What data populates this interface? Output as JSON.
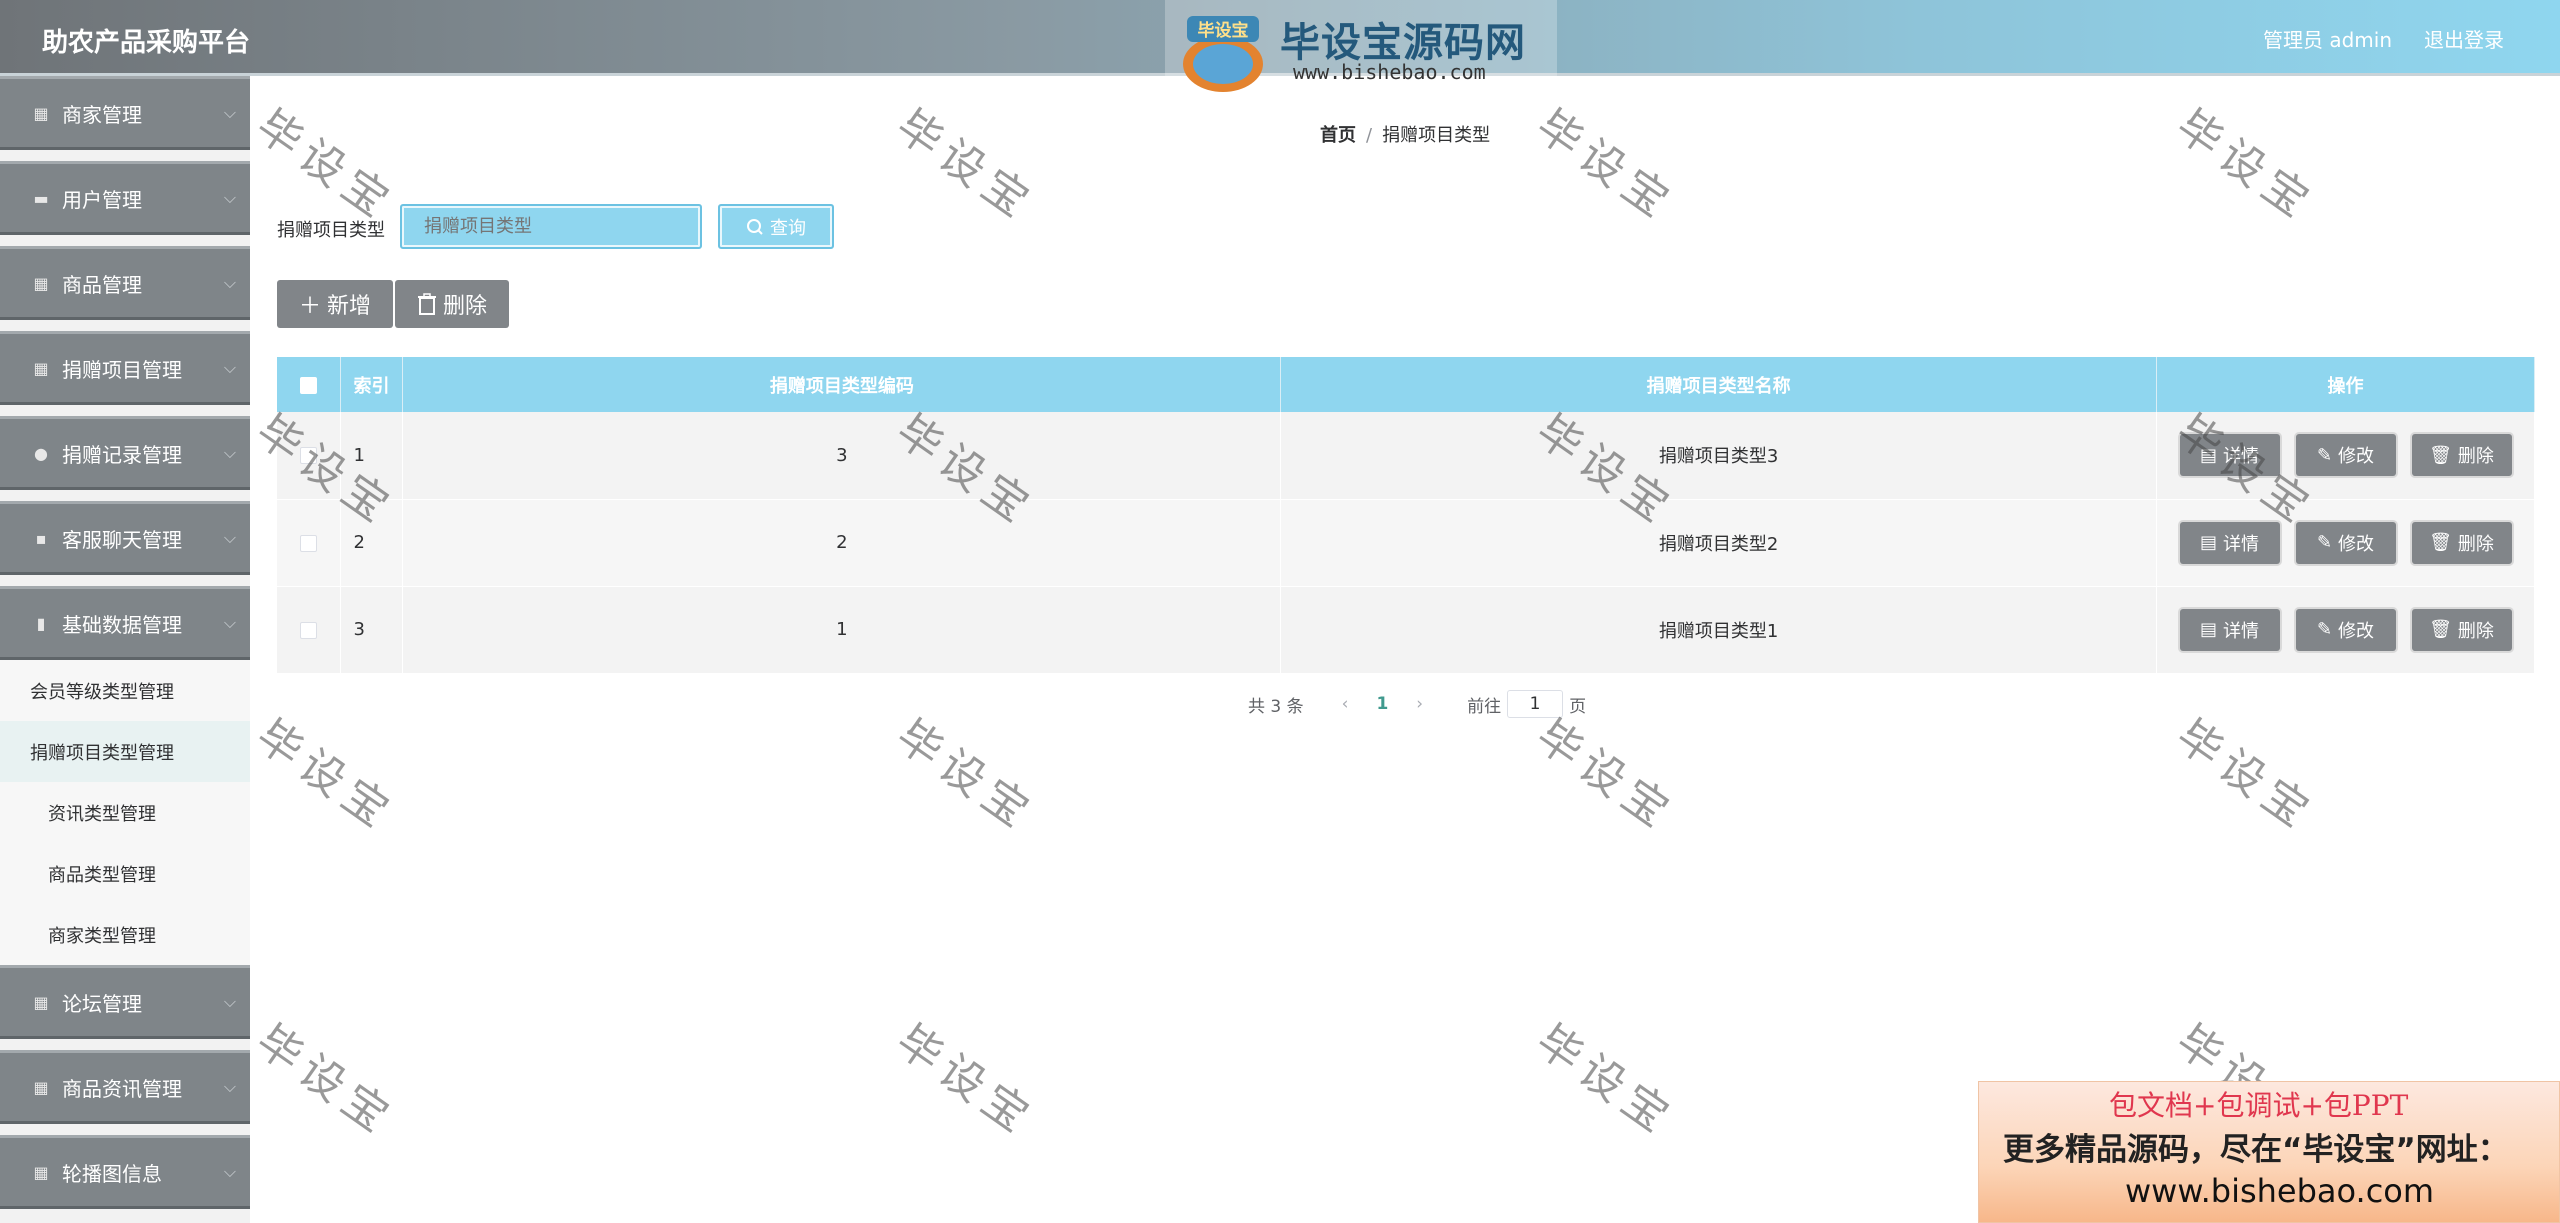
{
  "header": {
    "brand": "助农产品采购平台",
    "logo_badge": "毕设宝",
    "logo_main": "毕设宝源码网",
    "logo_url": "www.bishebao.com",
    "user": "管理员 admin",
    "logout": "退出登录"
  },
  "sidebar": {
    "items": [
      {
        "label": "商家管理",
        "icon": "grid-icon"
      },
      {
        "label": "用户管理",
        "icon": "ticket-icon"
      },
      {
        "label": "商品管理",
        "icon": "grid-icon"
      },
      {
        "label": "捐赠项目管理",
        "icon": "grid-icon"
      },
      {
        "label": "捐赠记录管理",
        "icon": "user-icon"
      },
      {
        "label": "客服聊天管理",
        "icon": "chat-icon"
      },
      {
        "label": "基础数据管理",
        "icon": "chart-icon"
      }
    ],
    "submenu": [
      {
        "label": "会员等级类型管理"
      },
      {
        "label": "捐赠项目类型管理"
      },
      {
        "label": "资讯类型管理"
      },
      {
        "label": "商品类型管理"
      },
      {
        "label": "商家类型管理"
      }
    ],
    "items_after": [
      {
        "label": "论坛管理",
        "icon": "grid-icon"
      },
      {
        "label": "商品资讯管理",
        "icon": "grid-icon"
      },
      {
        "label": "轮播图信息",
        "icon": "grid-icon"
      }
    ]
  },
  "breadcrumb": {
    "home": "首页",
    "sep": "/",
    "current": "捐赠项目类型"
  },
  "search": {
    "label": "捐赠项目类型",
    "placeholder": "捐赠项目类型",
    "button": "查询"
  },
  "actions": {
    "add": "新增",
    "delete": "删除"
  },
  "table": {
    "headers": [
      "索引",
      "捐赠项目类型编码",
      "捐赠项目类型名称",
      "操作"
    ],
    "rows": [
      {
        "index": "1",
        "code": "3",
        "name": "捐赠项目类型3"
      },
      {
        "index": "2",
        "code": "2",
        "name": "捐赠项目类型2"
      },
      {
        "index": "3",
        "code": "1",
        "name": "捐赠项目类型1"
      }
    ],
    "op_detail": "详情",
    "op_edit": "修改",
    "op_delete": "删除"
  },
  "pagination": {
    "total": "共 3 条",
    "current_page": "1",
    "goto_prefix": "前往",
    "goto_value": "1",
    "goto_suffix": "页"
  },
  "watermark": "毕设宝",
  "ad": {
    "line1": "包文档+包调试+包PPT",
    "line2": "更多精品源码，尽在“毕设宝”网址：",
    "line3": "www.bishebao.com"
  },
  "colors": {
    "header_accent": "#8fd6ef",
    "sidebar_item": "#7f8589",
    "button_gray": "#818589"
  }
}
